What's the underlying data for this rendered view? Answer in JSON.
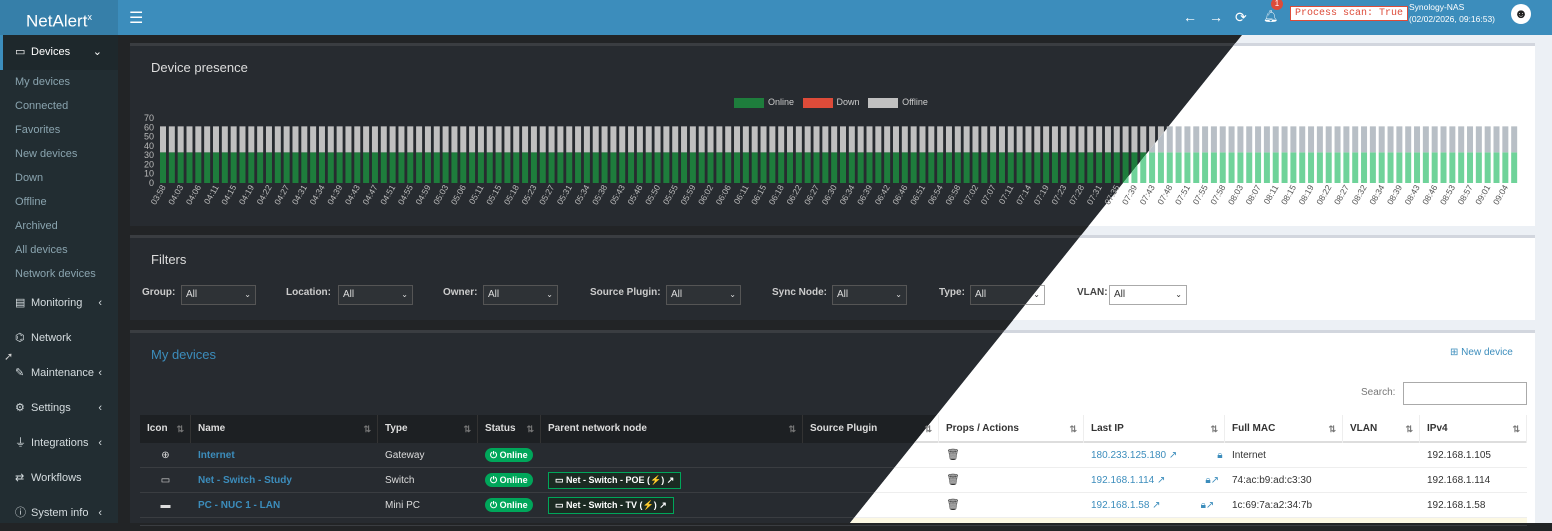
{
  "app": {
    "logo_text": "NetAlert",
    "logo_sup": "x",
    "process_scan": "Process scan: True",
    "notification_count": "1",
    "host_name": "Synology-NAS",
    "host_time": "(02/02/2026, 09:16:53)"
  },
  "icons": {
    "menu": "hamburger-icon",
    "back": "arrow-left-icon",
    "forward": "arrow-right-icon",
    "refresh": "refresh-icon",
    "bell": "bell-icon",
    "user": "user-avatar-icon"
  },
  "colors": {
    "online": "#00a65a",
    "down": "#dd4b39",
    "offline": "#c0c0c0",
    "accent": "#3c8dbc"
  },
  "sidebar": {
    "devices_label": "Devices",
    "sub_items": [
      "My devices",
      "Connected",
      "Favorites",
      "New devices",
      "Down",
      "Offline",
      "Archived",
      "All devices",
      "Network devices"
    ],
    "items": [
      {
        "label": "Monitoring",
        "icon": "chart-icon",
        "expandable": true
      },
      {
        "label": "Network",
        "icon": "network-icon",
        "expandable": false
      },
      {
        "label": "Maintenance",
        "icon": "wrench-icon",
        "expandable": true
      },
      {
        "label": "Settings",
        "icon": "gear-icon",
        "expandable": true
      },
      {
        "label": "Integrations",
        "icon": "plug-icon",
        "expandable": true
      },
      {
        "label": "Workflows",
        "icon": "shuffle-icon",
        "expandable": false
      },
      {
        "label": "System info",
        "icon": "info-icon",
        "expandable": true
      }
    ]
  },
  "presence": {
    "title": "Device presence",
    "legend": [
      {
        "name": "Online",
        "color": "#1e7d3c"
      },
      {
        "name": "Down",
        "color": "#dd4b39"
      },
      {
        "name": "Offline",
        "color": "#c0c0c0"
      }
    ]
  },
  "chart_data": {
    "type": "bar",
    "stacked": true,
    "ylim": [
      0,
      70
    ],
    "yticks": [
      0,
      10,
      20,
      30,
      40,
      50,
      60,
      70
    ],
    "x_labels": [
      "03:58",
      "04:03",
      "04:06",
      "04:11",
      "04:15",
      "04:19",
      "04:22",
      "04:27",
      "04:31",
      "04:34",
      "04:39",
      "04:43",
      "04:47",
      "04:51",
      "04:55",
      "04:59",
      "05:03",
      "05:06",
      "05:11",
      "05:15",
      "05:18",
      "05:23",
      "05:27",
      "05:31",
      "05:34",
      "05:38",
      "05:43",
      "05:46",
      "05:50",
      "05:55",
      "05:59",
      "06:02",
      "06:06",
      "06:11",
      "06:15",
      "06:18",
      "06:22",
      "06:27",
      "06:30",
      "06:34",
      "06:39",
      "06:42",
      "06:46",
      "06:51",
      "06:54",
      "06:58",
      "07:02",
      "07:07",
      "07:11",
      "07:14",
      "07:19",
      "07:23",
      "07:28",
      "07:31",
      "07:35",
      "07:39",
      "07:43",
      "07:48",
      "07:51",
      "07:55",
      "07:58",
      "08:03",
      "08:07",
      "08:11",
      "08:15",
      "08:19",
      "08:22",
      "08:27",
      "08:32",
      "08:34",
      "08:39",
      "08:43",
      "08:46",
      "08:53",
      "08:57",
      "09:01",
      "09:04"
    ],
    "bar_count": 154,
    "series": [
      {
        "name": "Online",
        "value": 33
      },
      {
        "name": "Down",
        "value": 0
      },
      {
        "name": "Offline",
        "value": 28
      }
    ]
  },
  "filters": {
    "title": "Filters",
    "items": [
      {
        "label": "Group:",
        "value": "All"
      },
      {
        "label": "Location:",
        "value": "All"
      },
      {
        "label": "Owner:",
        "value": "All"
      },
      {
        "label": "Source Plugin:",
        "value": "All"
      },
      {
        "label": "Sync Node:",
        "value": "All"
      },
      {
        "label": "Type:",
        "value": "All"
      },
      {
        "label": "VLAN:",
        "value": "All"
      }
    ]
  },
  "devices": {
    "title": "My devices",
    "new_device": "New device",
    "search_label": "Search:",
    "columns": [
      "Icon",
      "Name",
      "Type",
      "Status",
      "Parent network node",
      "Source Plugin",
      "Props / Actions",
      "Last IP",
      "Full MAC",
      "VLAN",
      "IPv4"
    ],
    "rows": [
      {
        "icon": "globe-icon",
        "name": "Internet",
        "type": "Gateway",
        "status": "Online",
        "parent": "",
        "last_ip": "180.233.125.180",
        "mac": "Internet",
        "vlan": "",
        "ipv4": "192.168.1.105"
      },
      {
        "icon": "switch-icon",
        "name": "Net - Switch - Study",
        "type": "Switch",
        "status": "Online",
        "parent": "Net - Switch - POE (⚡)",
        "last_ip": "192.168.1.114",
        "mac": "74:ac:b9:ad:c3:30",
        "vlan": "",
        "ipv4": "192.168.1.114"
      },
      {
        "icon": "minipc-icon",
        "name": "PC - NUC 1 - LAN",
        "type": "Mini PC",
        "status": "Online",
        "parent": "Net - Switch - TV (⚡)",
        "last_ip": "192.168.1.58",
        "mac": "1c:69:7a:a2:34:7b",
        "vlan": "",
        "ipv4": "192.168.1.58"
      }
    ]
  }
}
